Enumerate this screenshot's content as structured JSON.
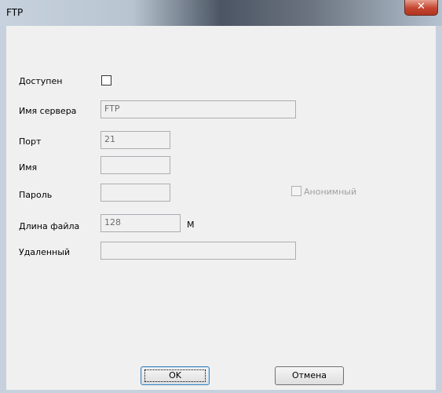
{
  "window": {
    "title": "FTP",
    "close_glyph": "✕"
  },
  "form": {
    "enabled_label": "Доступен",
    "server_label": "Имя сервера",
    "server_value": "FTP",
    "port_label": "Порт",
    "port_value": "21",
    "username_label": "Имя",
    "username_value": "",
    "password_label": "Пароль",
    "password_value": "",
    "anonymous_label": "Анонимный",
    "file_length_label": "Длина файла",
    "file_length_value": "128",
    "file_length_unit": "М",
    "remote_label": "Удаленный",
    "remote_value": ""
  },
  "buttons": {
    "ok": "OK",
    "cancel": "Отмена"
  }
}
